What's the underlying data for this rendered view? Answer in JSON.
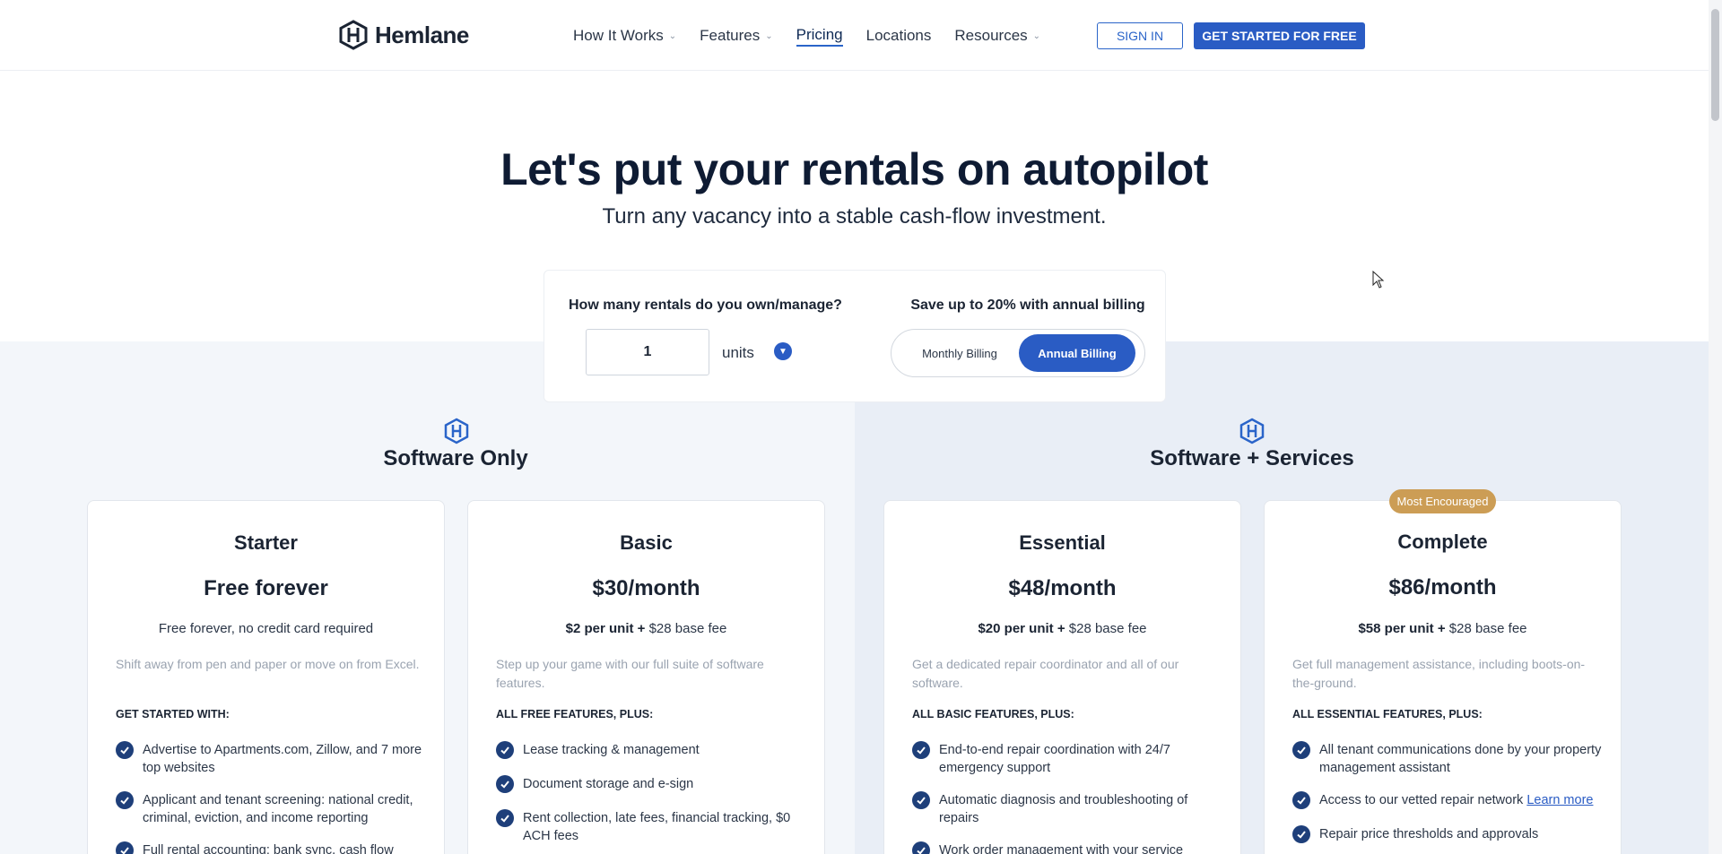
{
  "nav": {
    "logo": "Hemlane",
    "items": [
      {
        "label": "How It Works",
        "dropdown": true
      },
      {
        "label": "Features",
        "dropdown": true
      },
      {
        "label": "Pricing",
        "dropdown": false,
        "active": true
      },
      {
        "label": "Locations",
        "dropdown": false
      },
      {
        "label": "Resources",
        "dropdown": true
      }
    ],
    "signin": "SIGN IN",
    "get_started": "GET STARTED FOR FREE"
  },
  "hero": {
    "title": "Let's put your rentals on autopilot",
    "subtitle": "Turn any vacancy into a stable cash-flow investment."
  },
  "calculator": {
    "question": "How many rentals do you own/manage?",
    "units_value": "1",
    "units_label": "units",
    "save_label": "Save up to 20% with annual billing",
    "monthly": "Monthly Billing",
    "annual": "Annual Billing",
    "selected": "Annual Billing"
  },
  "groups": {
    "software": "Software Only",
    "services": "Software + Services"
  },
  "badge": "Most Encouraged",
  "plans": [
    {
      "name": "Starter",
      "price": "Free forever",
      "fee_bold": "",
      "fee_rest": "Free forever, no credit card required",
      "desc": "Shift away from pen and paper or move on from Excel.",
      "section": "GET STARTED WITH:",
      "features": [
        "Advertise to Apartments.com, Zillow, and 7 more top websites",
        "Applicant and tenant screening: national credit, criminal, eviction, and income reporting",
        "Full rental accounting: bank sync, cash flow"
      ]
    },
    {
      "name": "Basic",
      "price": "$30/month",
      "fee_bold": "$2 per unit +",
      "fee_rest": " $28 base fee",
      "desc": "Step up your game with our full suite of software features.",
      "section": "ALL FREE FEATURES, PLUS:",
      "features": [
        "Lease tracking & management",
        "Document storage and e-sign",
        "Rent collection, late fees, financial tracking, $0 ACH fees"
      ]
    },
    {
      "name": "Essential",
      "price": "$48/month",
      "fee_bold": "$20 per unit +",
      "fee_rest": " $28 base fee",
      "desc": "Get a dedicated repair coordinator and all of our software.",
      "section": "ALL BASIC FEATURES, PLUS:",
      "features": [
        "End-to-end repair coordination with 24/7 emergency support",
        "Automatic diagnosis and troubleshooting of repairs",
        "Work order management with your service"
      ]
    },
    {
      "name": "Complete",
      "price": "$86/month",
      "fee_bold": "$58 per unit +",
      "fee_rest": " $28 base fee",
      "desc": "Get full management assistance, including boots-on-the-ground.",
      "section": "ALL ESSENTIAL FEATURES, PLUS:",
      "features": [
        "All tenant communications done by your property management assistant",
        "Access to our vetted repair network",
        "Repair price thresholds and approvals"
      ],
      "learn_more": "Learn more"
    }
  ],
  "colors": {
    "brand_blue": "#2a5cc4",
    "check_navy": "#1e3f7a",
    "badge_gold": "#cc9d55"
  }
}
